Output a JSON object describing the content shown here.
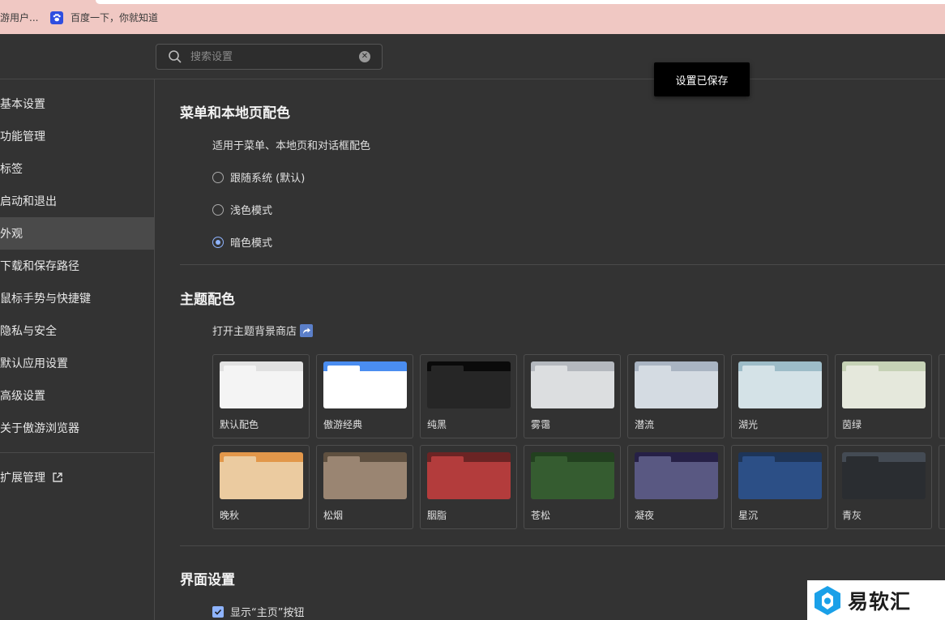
{
  "bookmarks": [
    {
      "label": "游用户..."
    },
    {
      "label": "百度一下，你就知道"
    }
  ],
  "search": {
    "placeholder": "搜索设置"
  },
  "toast": {
    "text": "设置已保存"
  },
  "sidebar": {
    "items": [
      {
        "label": "基本设置"
      },
      {
        "label": "功能管理"
      },
      {
        "label": "标签"
      },
      {
        "label": "启动和退出"
      },
      {
        "label": "外观",
        "active": true
      },
      {
        "label": "下载和保存路径"
      },
      {
        "label": "鼠标手势与快捷键"
      },
      {
        "label": "隐私与安全"
      },
      {
        "label": "默认应用设置"
      },
      {
        "label": "高级设置"
      },
      {
        "label": "关于傲游浏览器"
      }
    ],
    "extensions_label": "扩展管理"
  },
  "menu_color": {
    "title": "菜单和本地页配色",
    "description": "适用于菜单、本地页和对话框配色",
    "options": [
      {
        "label": "跟随系统 (默认)",
        "checked": false
      },
      {
        "label": "浅色模式",
        "checked": false
      },
      {
        "label": "暗色模式",
        "checked": true
      }
    ]
  },
  "theme": {
    "title": "主题配色",
    "store_link": "打开主题背景商店",
    "themes": [
      {
        "name": "默认配色",
        "bar": "#e1e1e1",
        "tab": "#f4f4f4",
        "body": "#f4f4f4"
      },
      {
        "name": "傲游经典",
        "bar": "#4a8df0",
        "tab": "#ffffff",
        "body": "#ffffff"
      },
      {
        "name": "纯黑",
        "bar": "#0a0a0a",
        "tab": "#262626",
        "body": "#262626"
      },
      {
        "name": "雾霭",
        "bar": "#b4b8be",
        "tab": "#dcdee0",
        "body": "#dcdee0"
      },
      {
        "name": "潜流",
        "bar": "#a9b4c2",
        "tab": "#d4dbe2",
        "body": "#d4dbe2"
      },
      {
        "name": "湖光",
        "bar": "#9dbcc8",
        "tab": "#d4e2e7",
        "body": "#d4e2e7"
      },
      {
        "name": "茵绿",
        "bar": "#c6d2b6",
        "tab": "#e5e8dc",
        "body": "#e5e8dc"
      },
      {
        "name": "晚秋",
        "bar": "#e2974a",
        "tab": "#ebcba0",
        "body": "#ebcba0"
      },
      {
        "name": "松烟",
        "bar": "#5f5040",
        "tab": "#9a8572",
        "body": "#9a8572"
      },
      {
        "name": "胭脂",
        "bar": "#6b2424",
        "tab": "#b33c3c",
        "body": "#b33c3c"
      },
      {
        "name": "苍松",
        "bar": "#22401f",
        "tab": "#355c30",
        "body": "#355c30"
      },
      {
        "name": "凝夜",
        "bar": "#262046",
        "tab": "#595882",
        "body": "#595882"
      },
      {
        "name": "星沉",
        "bar": "#1e3558",
        "tab": "#2c4f86",
        "body": "#2c4f86"
      },
      {
        "name": "青灰",
        "bar": "#444b54",
        "tab": "#2a2d31",
        "body": "#2a2d31"
      }
    ]
  },
  "interface": {
    "title": "界面设置",
    "show_home_label": "显示“主页”按钮",
    "show_home_checked": true
  },
  "watermark": {
    "text": "易软汇"
  },
  "colors": {
    "accent": "#8fb4ff",
    "background": "#333333",
    "bookmark_bar": "#f0c8c3"
  }
}
